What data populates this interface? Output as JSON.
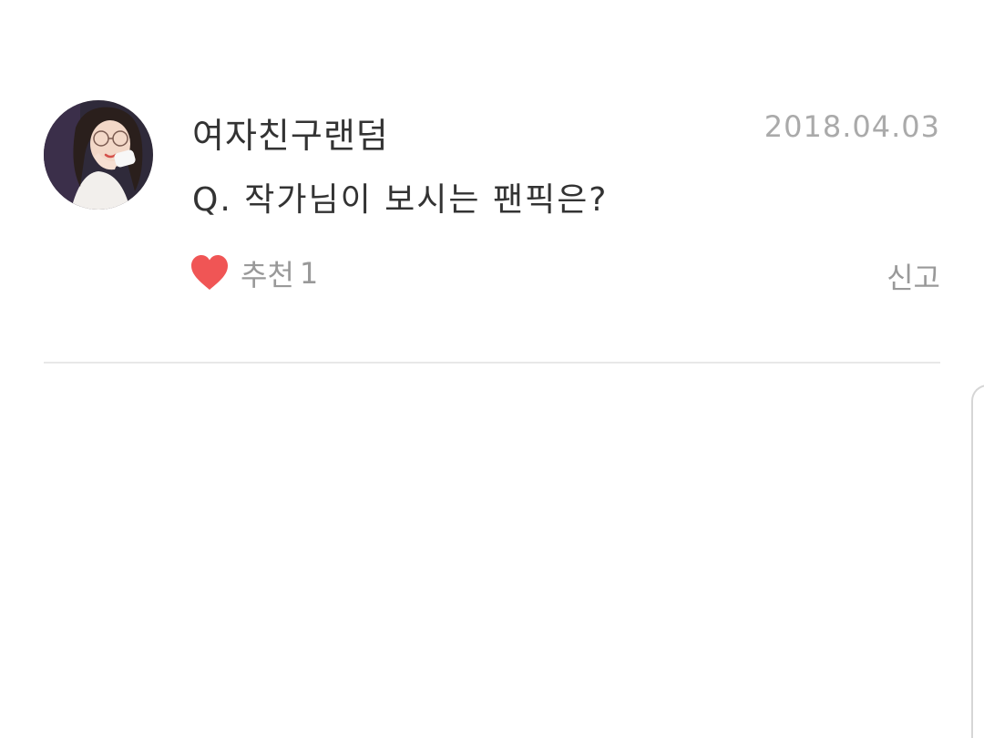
{
  "comment": {
    "author": "여자친구랜덤",
    "date": "2018.04.03",
    "question": "Q. 작가님이 보시는 팬픽은?",
    "like_label": "추천",
    "like_count": "1",
    "report_label": "신고",
    "avatar_icon": "profile-photo",
    "like_icon": "heart-icon"
  },
  "colors": {
    "heart": "#f05555",
    "muted_text": "#999999",
    "date_text": "#aaaaaa",
    "primary_text": "#333333",
    "divider": "#e8e8e8"
  }
}
